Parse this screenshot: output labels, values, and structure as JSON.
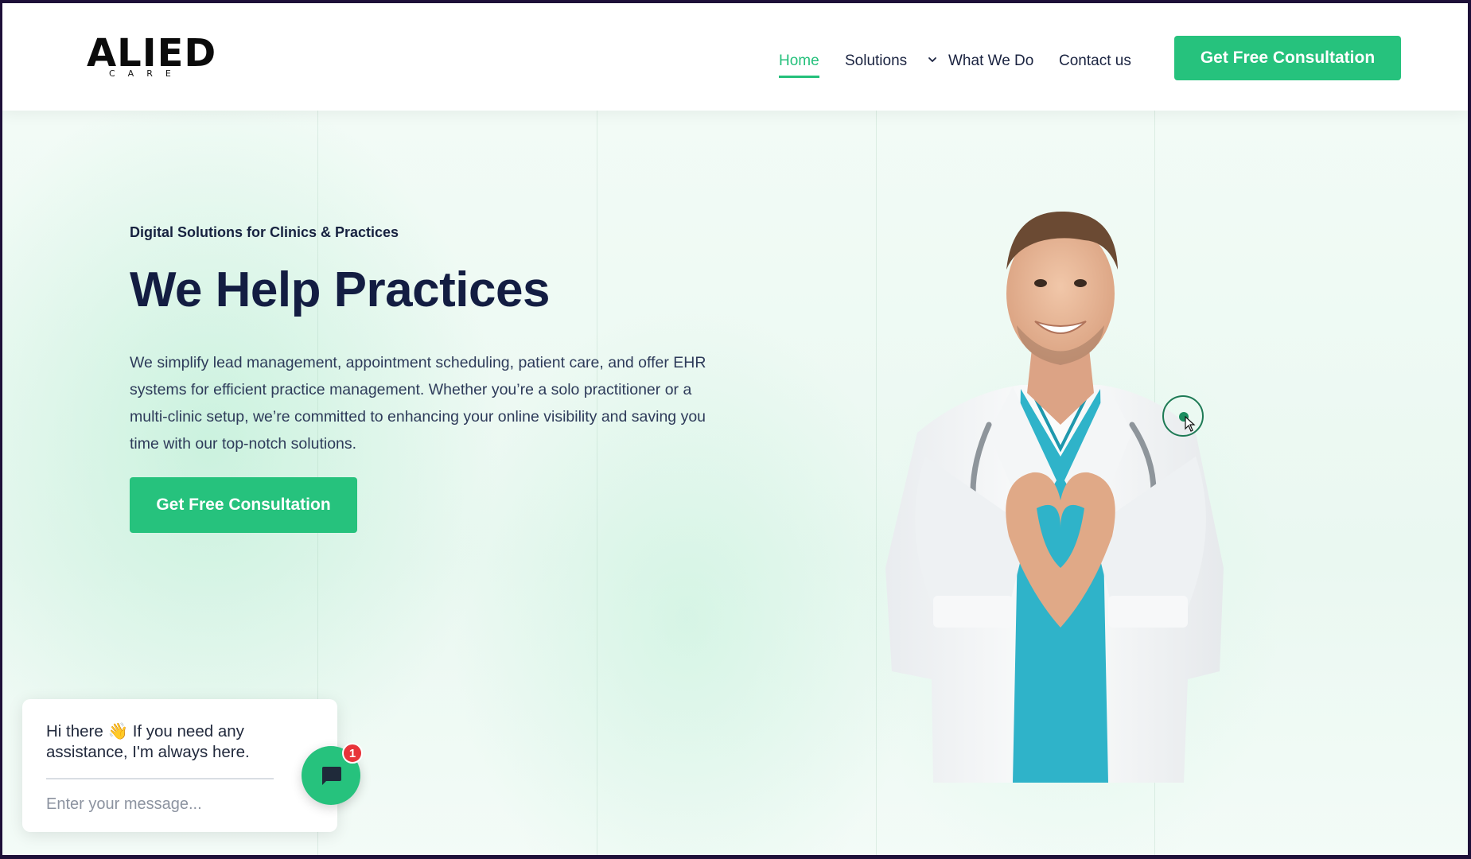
{
  "header": {
    "logo_text": "ALIED",
    "logo_sub": "CARE",
    "nav": [
      {
        "label": "Home",
        "active": true
      },
      {
        "label": "Solutions",
        "has_dropdown": true
      },
      {
        "label": "What We Do"
      },
      {
        "label": "Contact us"
      }
    ],
    "cta_label": "Get Free Consultation"
  },
  "hero": {
    "eyebrow": "Digital Solutions for Clinics & Practices",
    "title": "We Help Practices",
    "description": "We simplify lead management, appointment scheduling, patient care, and offer EHR systems for efficient practice management. Whether you’re a solo practitioner or a multi-clinic setup, we’re committed to enhancing your online visibility and saving you time with our top-notch solutions.",
    "cta_label": "Get Free Consultation",
    "image_icon": "doctor-heart-hands-illustration"
  },
  "chat": {
    "greeting": "Hi there 👋 If you need any assistance, I'm always here.",
    "input_placeholder": "Enter your message...",
    "badge_count": "1",
    "launcher_icon": "chat-bubble-icon"
  },
  "colors": {
    "accent": "#26c27d",
    "heading": "#131d42",
    "frame": "#1e1039",
    "badge": "#e8343a"
  }
}
